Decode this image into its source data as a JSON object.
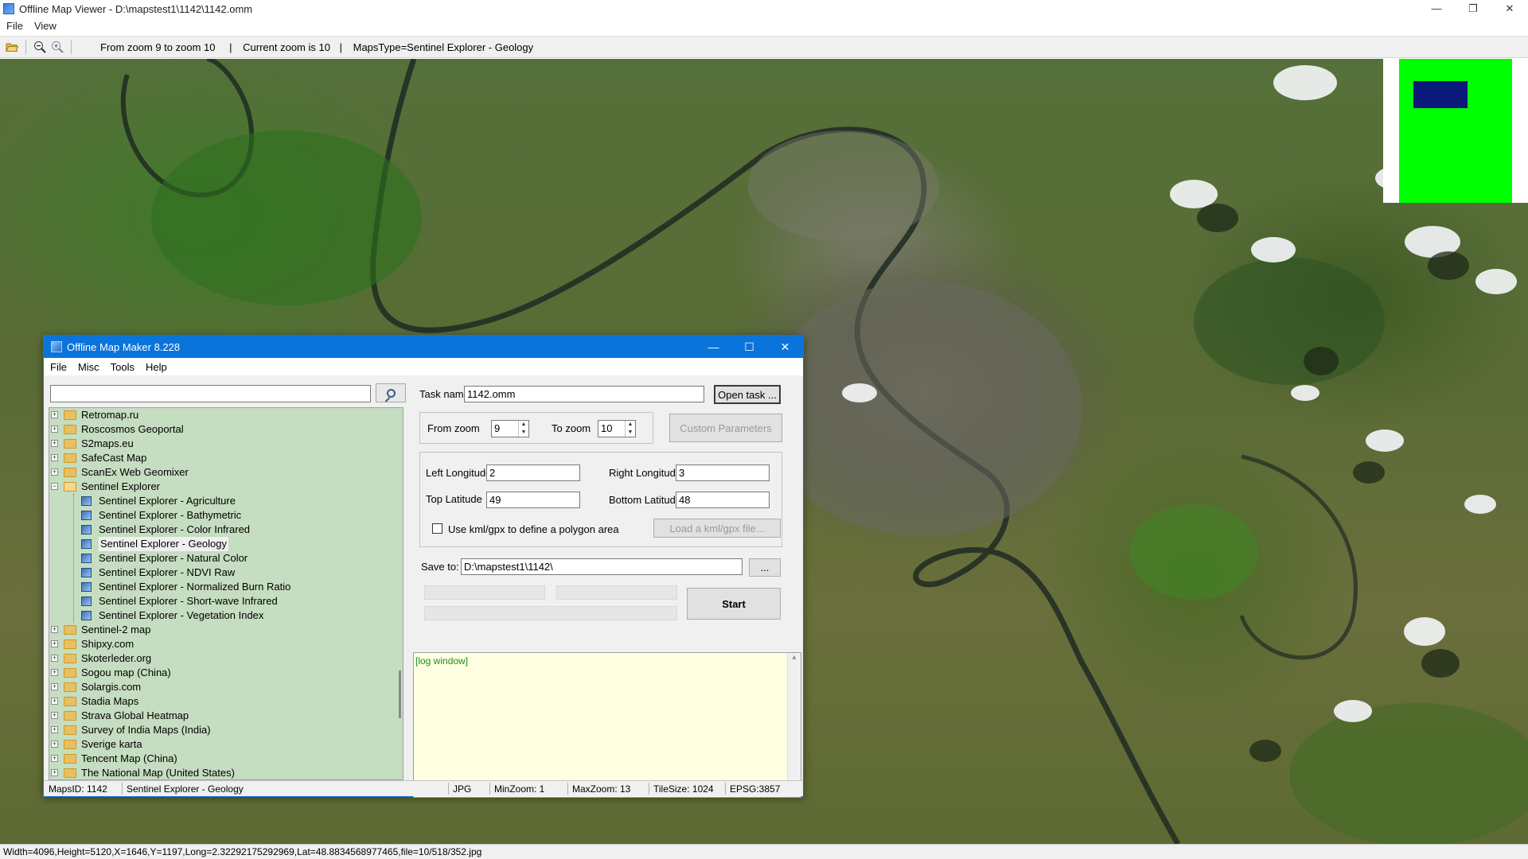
{
  "window": {
    "title": "Offline Map Viewer - D:\\mapstest1\\1142\\1142.omm",
    "menu": [
      "File",
      "View"
    ],
    "controls": {
      "minimize": "—",
      "restore": "❐",
      "close": "✕"
    }
  },
  "toolbar": {
    "icons": [
      "open-folder-icon",
      "zoom-out-icon",
      "zoom-in-icon"
    ],
    "zoom_range": "From zoom 9 to zoom 10",
    "current_zoom": "Current zoom is 10",
    "maps_type": "MapsType=Sentinel Explorer - Geology",
    "sep": "|"
  },
  "statusbar": {
    "text": "Width=4096,Height=5120,X=1646,Y=1197,Long=2.32292175292969,Lat=48.8834568977465,file=10/518/352.jpg"
  },
  "dialog": {
    "title": "Offline Map Maker 8.228",
    "menu": [
      "File",
      "Misc",
      "Tools",
      "Help"
    ],
    "search": {
      "value": "",
      "placeholder": ""
    },
    "tree": {
      "items": [
        {
          "label": "Retromap.ru",
          "expanded": false
        },
        {
          "label": "Roscosmos Geoportal",
          "expanded": false
        },
        {
          "label": "S2maps.eu",
          "expanded": false
        },
        {
          "label": "SafeCast Map",
          "expanded": false
        },
        {
          "label": "ScanEx Web Geomixer",
          "expanded": false
        },
        {
          "label": "Sentinel Explorer",
          "expanded": true
        }
      ],
      "children": [
        "Sentinel Explorer - Agriculture",
        "Sentinel Explorer - Bathymetric",
        "Sentinel Explorer - Color Infrared",
        "Sentinel Explorer - Geology",
        "Sentinel Explorer - Natural Color",
        "Sentinel Explorer - NDVI Raw",
        "Sentinel Explorer - Normalized Burn Ratio",
        "Sentinel Explorer - Short-wave Infrared",
        "Sentinel Explorer - Vegetation Index"
      ],
      "selected_child": "Sentinel Explorer - Geology",
      "items_after": [
        "Sentinel-2 map",
        "Shipxy.com",
        "Skoterleder.org",
        "Sogou map (China)",
        "Solargis.com",
        "Stadia Maps",
        "Strava Global Heatmap",
        "Survey of India Maps (India)",
        "Sverige karta",
        "Tencent Map (China)",
        "The National Map (United States)"
      ]
    },
    "task": {
      "label": "Task name",
      "value": "1142.omm",
      "open_button": "Open task ..."
    },
    "zoom": {
      "from_label": "From zoom",
      "from_value": "9",
      "to_label": "To zoom",
      "to_value": "10",
      "custom_button": "Custom Parameters"
    },
    "coords": {
      "left_label": "Left Longitude",
      "left_value": "2",
      "right_label": "Right Longitude",
      "right_value": "3",
      "top_label": "Top Latitude",
      "top_value": "49",
      "bottom_label": "Bottom Latitude",
      "bottom_value": "48",
      "kml_checkbox": "Use kml/gpx to define a polygon area",
      "kml_checked": false,
      "load_kml_button": "Load a kml/gpx file..."
    },
    "save": {
      "label": "Save to:",
      "value": "D:\\mapstest1\\1142\\",
      "browse_button": "...",
      "start_button": "Start"
    },
    "log": {
      "text": "[log window]"
    },
    "status": {
      "maps_id": "MapsID: 1142",
      "maps_name": "Sentinel Explorer - Geology",
      "format": "JPG",
      "min_zoom": "MinZoom: 1",
      "max_zoom": "MaxZoom: 13",
      "tile_size": "TileSize: 1024",
      "epsg": "EPSG:3857"
    }
  },
  "colors": {
    "accent": "#0a74da",
    "tree_bg": "#c5ddc0",
    "log_bg": "#ffffe1",
    "log_text": "#1f8a1f",
    "minimap_bg": "#00ff00",
    "minimap_view": "#0a1a7a"
  }
}
